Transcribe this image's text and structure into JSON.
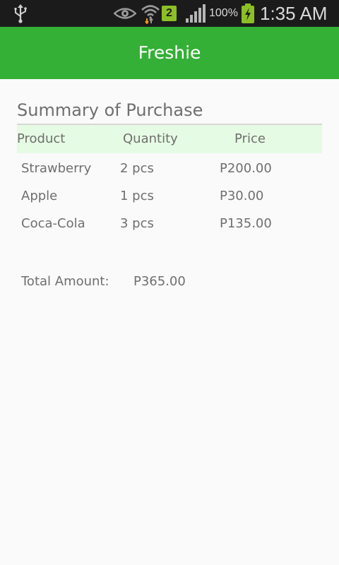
{
  "status_bar": {
    "icons": [
      "usb-icon",
      "eye-icon",
      "wifi-icon",
      "sim-icon",
      "signal-icon",
      "battery-charging-icon"
    ],
    "sim_label": "2",
    "battery_percent": "100%",
    "time": "1:35 AM"
  },
  "action_bar": {
    "title": "Freshie",
    "color": "#33b035"
  },
  "summary": {
    "title": "Summary of Purchase",
    "columns": [
      "Product",
      "Quantity",
      "Price"
    ],
    "rows": [
      {
        "product": "Strawberry",
        "quantity": "2 pcs",
        "price": "P200.00"
      },
      {
        "product": "Apple",
        "quantity": "1 pcs",
        "price": "P30.00"
      },
      {
        "product": "Coca-Cola",
        "quantity": "3 pcs",
        "price": "P135.00"
      }
    ],
    "total_label": "Total Amount:",
    "total_value": "P365.00"
  }
}
